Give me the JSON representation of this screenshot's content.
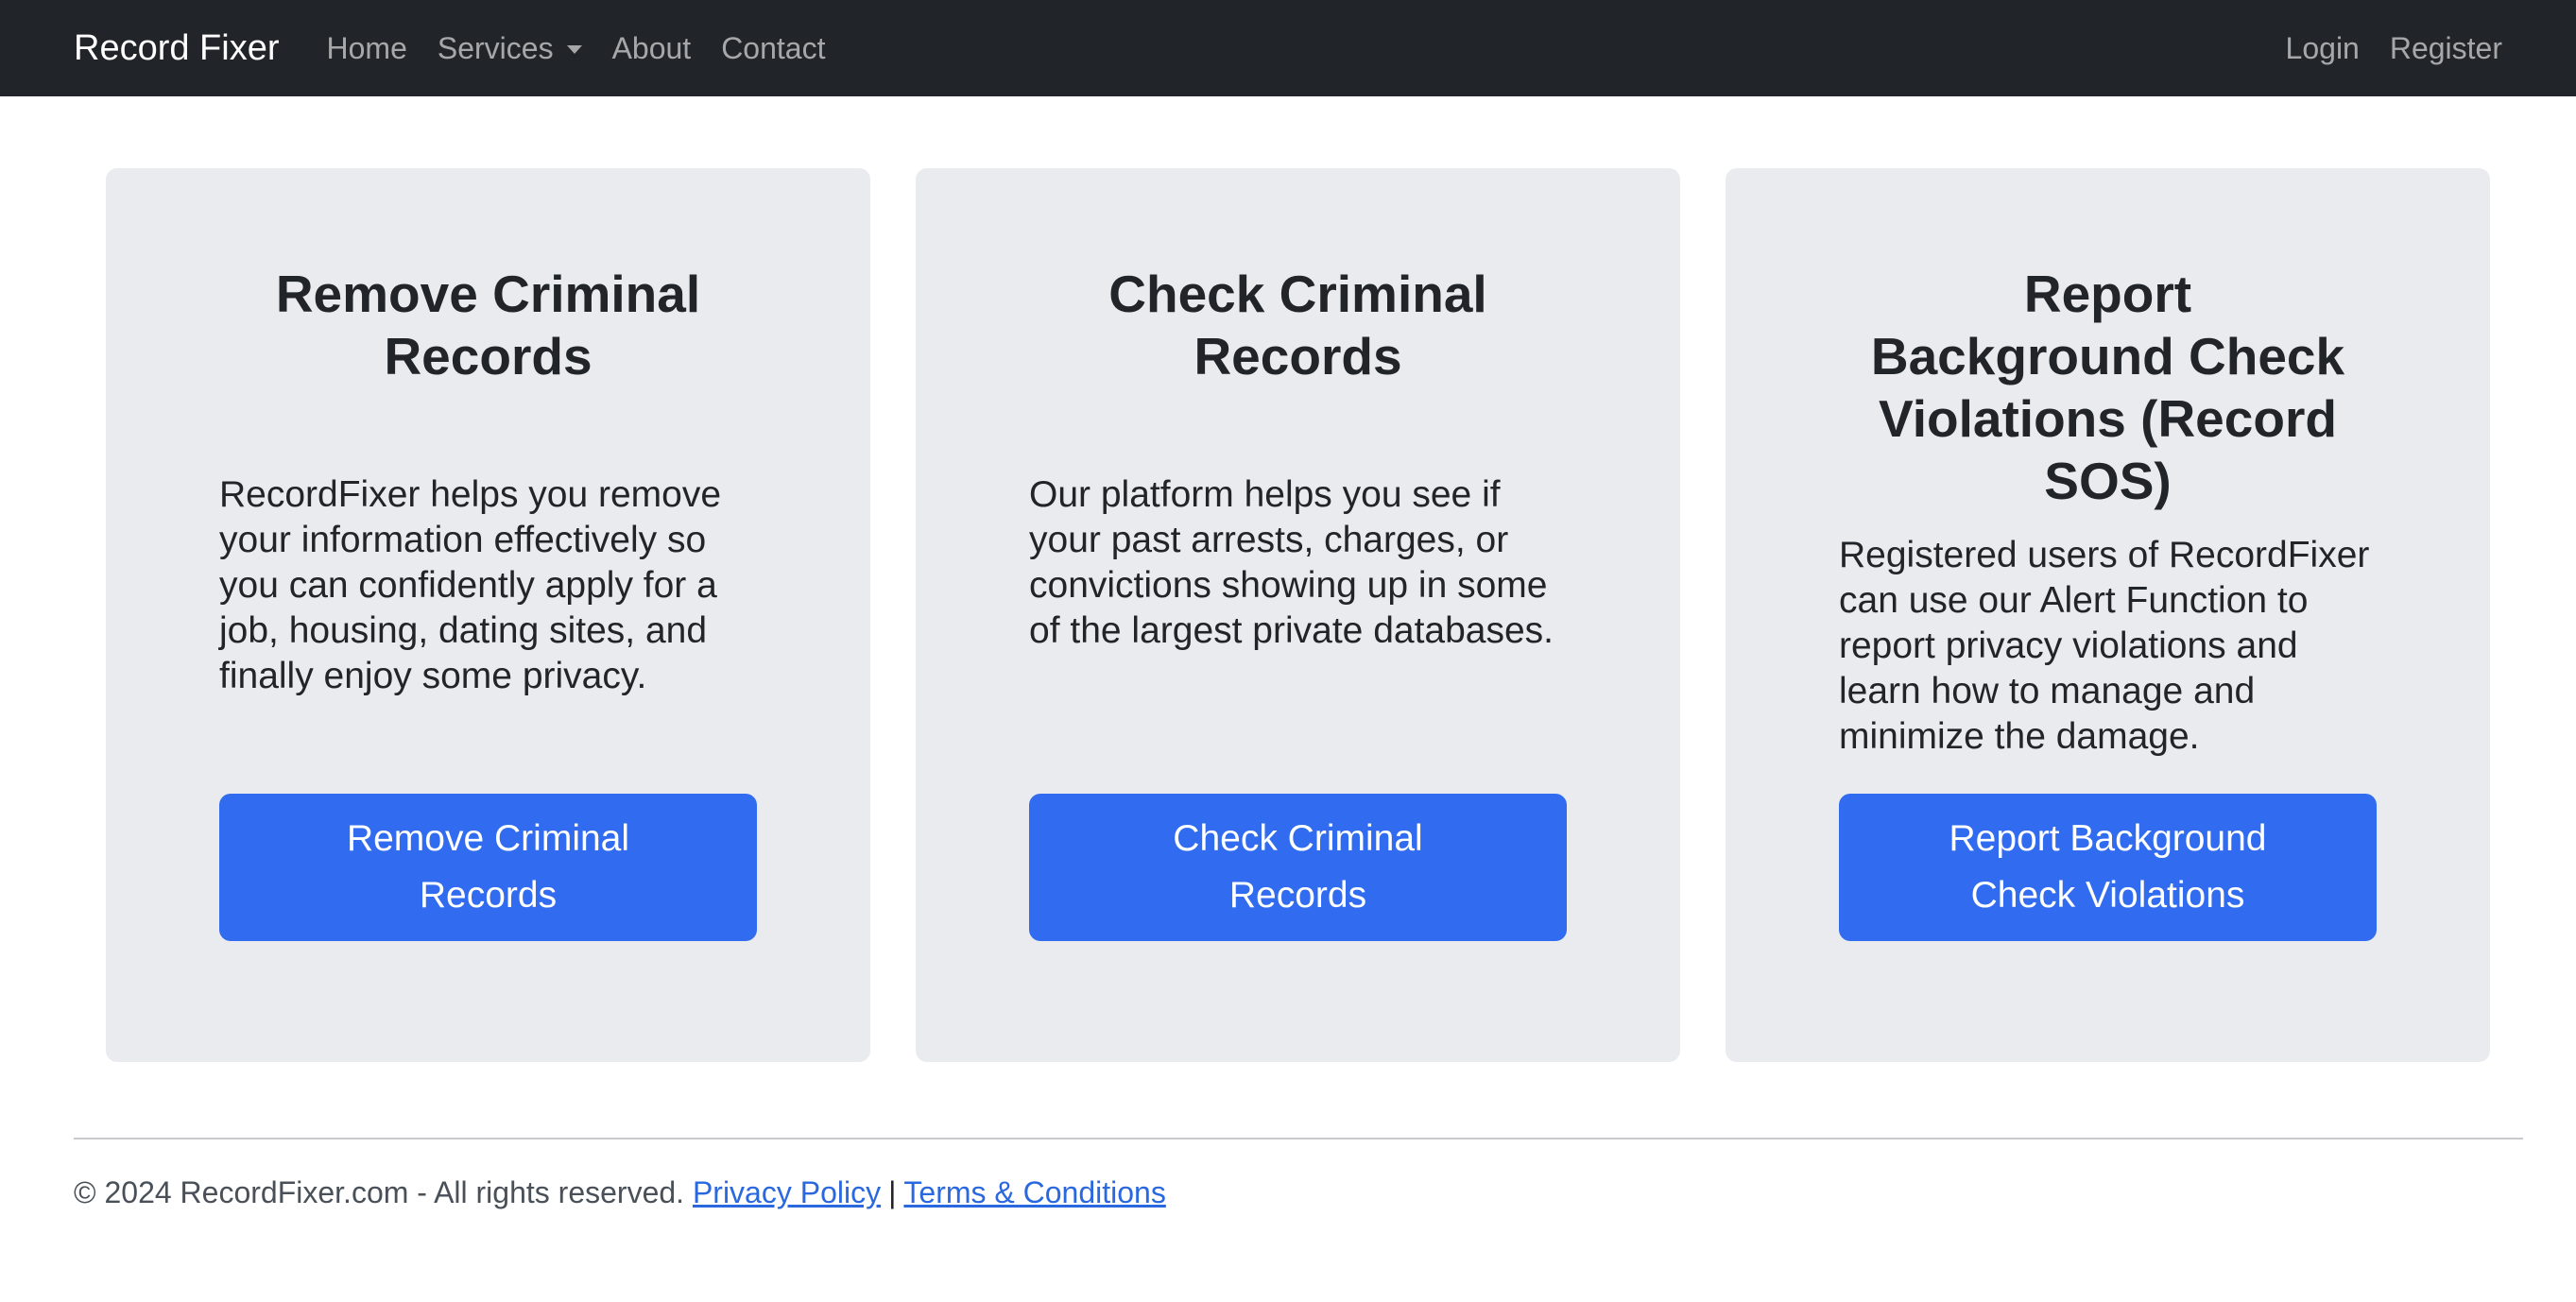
{
  "navbar": {
    "brand": "Record Fixer",
    "links": [
      {
        "label": "Home"
      },
      {
        "label": "Services",
        "dropdown": true
      },
      {
        "label": "About"
      },
      {
        "label": "Contact"
      }
    ],
    "right": [
      {
        "label": "Login"
      },
      {
        "label": "Register"
      }
    ]
  },
  "cards": [
    {
      "title": "Remove Criminal Records",
      "text": "RecordFixer helps you remove your information effectively so you can confidently apply for a job, housing, dating sites, and finally enjoy some privacy.",
      "button": "Remove Criminal Records"
    },
    {
      "title": "Check Criminal Records",
      "text": "Our platform helps you see if your past arrests, charges, or convictions showing up in some of the largest private databases.",
      "button": "Check Criminal Records"
    },
    {
      "title": "Report Background Check Violations (Record SOS)",
      "text": "Registered users of RecordFixer can use our Alert Function to report privacy violations and learn how to manage and minimize the damage.",
      "button": "Report Background Check Violations"
    }
  ],
  "footer": {
    "copyright": "© 2024 RecordFixer.com - All rights reserved.",
    "privacy": "Privacy Policy",
    "separator": "|",
    "terms": "Terms & Conditions"
  },
  "colors": {
    "navbar_bg": "#212529",
    "card_bg": "#e9ebee",
    "button_bg": "#316cf0",
    "link": "#2a68e0"
  }
}
